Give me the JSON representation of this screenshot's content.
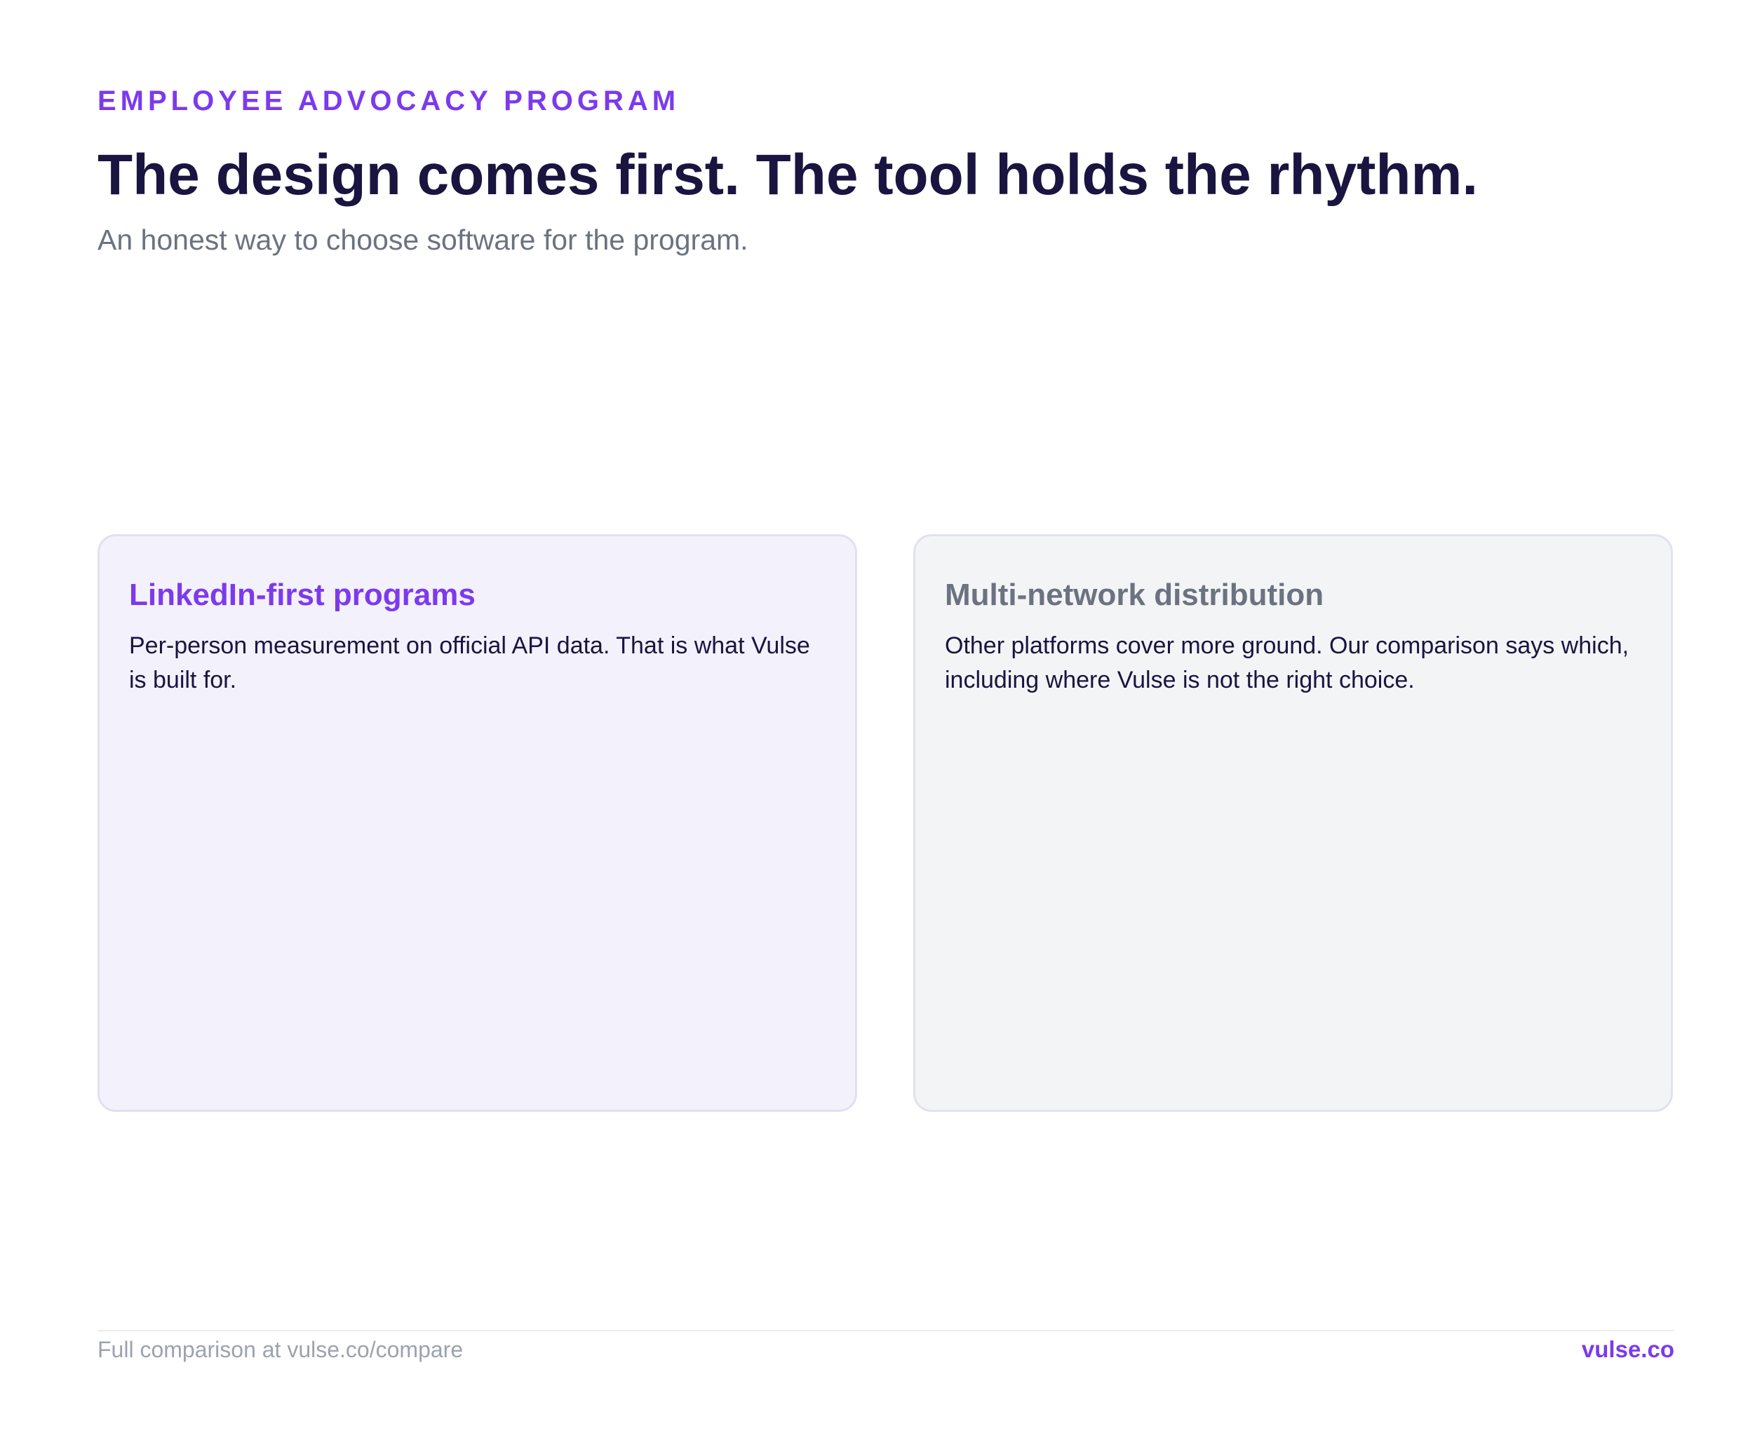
{
  "header": {
    "eyebrow": "EMPLOYEE ADVOCACY PROGRAM",
    "title": "The design comes first. The tool holds the rhythm.",
    "subtitle": "An honest way to choose software for the program."
  },
  "cards": [
    {
      "title": "LinkedIn-first programs",
      "body": "Per-person measurement on official API data. That is what Vulse is built for."
    },
    {
      "title": "Multi-network distribution",
      "body": "Other platforms cover more ground. Our comparison says which, including where Vulse is not the right choice."
    }
  ],
  "footer": {
    "left_text": "Full comparison at vulse.co/compare",
    "brand": "vulse.co"
  },
  "colors": {
    "accent": "#7c3aed",
    "heading": "#1a1440",
    "muted": "#6b7280",
    "card_left_bg": "#f3f1fb",
    "card_right_bg": "#f3f4f6"
  }
}
